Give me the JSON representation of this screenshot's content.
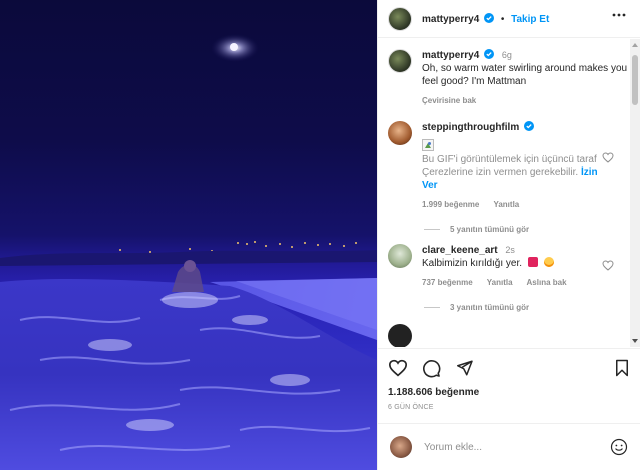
{
  "header": {
    "username": "mattyperry4",
    "separator": "•",
    "follow_label": "Takip Et",
    "more_icon": "more-horizontal-icon"
  },
  "caption": {
    "username": "mattyperry4",
    "time": "6g",
    "text": "Oh, so warm water swirling around makes you feel good? I'm Mattman",
    "translate_label": "Çevirisine bak"
  },
  "comments": [
    {
      "username": "steppingthroughfilm",
      "gif_notice": "Bu GIF'i görüntülemek için üçüncü taraf Çerezlerine izin vermen gerekebilir.",
      "allow_label": "İzin Ver",
      "likes": "1.999 beğenme",
      "reply_label": "Yanıtla",
      "view_replies": "5 yanıtın tümünü gör"
    },
    {
      "username": "clare_keene_art",
      "time": "2s",
      "text": "Kalbimizin kırıldığı yer.",
      "likes": "737 beğenme",
      "reply_label": "Yanıtla",
      "translate_label": "Aslına bak",
      "view_replies": "3 yanıtın tümünü gör"
    }
  ],
  "actions": {
    "like_count": "1.188.606 beğenme",
    "date": "6 GÜN ÖNCE"
  },
  "add_comment": {
    "placeholder": "Yorum ekle..."
  },
  "colors": {
    "link_blue": "#0095f6",
    "text": "#262626",
    "muted": "#8e8e8e",
    "night_blue": "#2d2ac0"
  }
}
